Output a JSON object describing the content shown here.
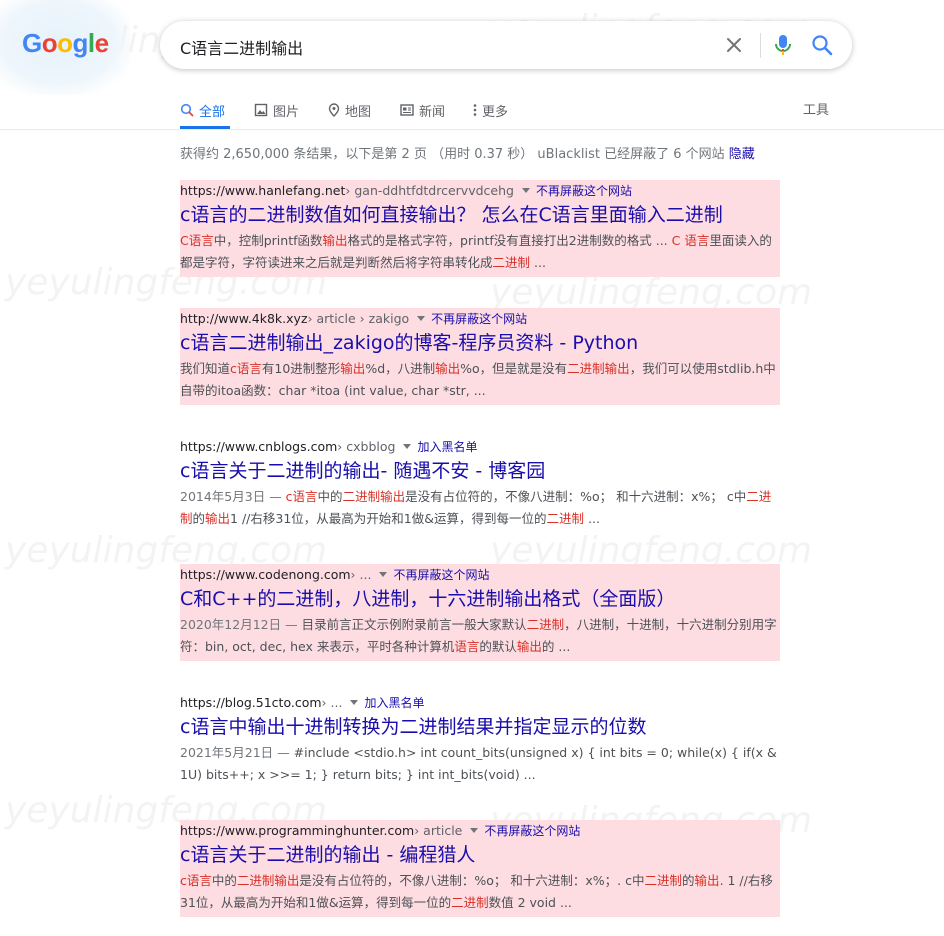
{
  "logo": {
    "text": "Google"
  },
  "search": {
    "query": "C语言二进制输出"
  },
  "tabs": [
    {
      "label": "全部",
      "icon": "search-icon"
    },
    {
      "label": "图片",
      "icon": "image-icon"
    },
    {
      "label": "地图",
      "icon": "map-pin-icon"
    },
    {
      "label": "新闻",
      "icon": "news-icon"
    },
    {
      "label": "更多",
      "icon": "more-vert-icon"
    }
  ],
  "tools_label": "工具",
  "stats": {
    "text": "获得约 2,650,000 条结果，以下是第 2 页 （用时 0.37 秒） uBlacklist 已经屏蔽了 6 个网站",
    "hide_link": "隐藏"
  },
  "results": [
    {
      "domain": "https://www.hanlefang.net",
      "crumbs": " › gan-ddhtfdtdrcervvdcehg",
      "action": "不再屏蔽这个网站",
      "blocked": true,
      "title": "c语言的二进制数值如何直接输出？ 怎么在C语言里面输入二进制",
      "snippet": [
        [
          "C语言",
          true
        ],
        [
          "中，控制printf函数",
          false
        ],
        [
          "输出",
          true
        ],
        [
          "格式的是格式字符，printf没有直接打出2进制数的格式 ... ",
          false
        ],
        [
          "C 语言",
          true
        ],
        [
          "里面读入的都是字符，字符读进来之后就是判断然后将字符串转化成",
          false
        ],
        [
          "二进制",
          true
        ],
        [
          " ...",
          false
        ]
      ]
    },
    {
      "domain": "http://www.4k8k.xyz",
      "crumbs": " › article › zakigo",
      "action": "不再屏蔽这个网站",
      "blocked": true,
      "title": "c语言二进制输出_zakigo的博客-程序员资料 - Python",
      "snippet": [
        [
          "我们知道",
          false
        ],
        [
          "c语言",
          true
        ],
        [
          "有10进制整形",
          false
        ],
        [
          "输出",
          true
        ],
        [
          "%d，八进制",
          false
        ],
        [
          "输出",
          true
        ],
        [
          "%o，但是就是没有",
          false
        ],
        [
          "二进制输出",
          true
        ],
        [
          "，我们可以使用stdlib.h中自带的itoa函数：char *itoa (int value, char *str, ...",
          false
        ]
      ]
    },
    {
      "domain": "https://www.cnblogs.com",
      "crumbs": " › cxbblog",
      "action": "加入黑名单",
      "blocked": false,
      "title": "c语言关于二进制的输出- 随遇不安 - 博客园",
      "date": "2014年5月3日 — ",
      "snippet": [
        [
          "c语言",
          true
        ],
        [
          "中的",
          false
        ],
        [
          "二进制输出",
          true
        ],
        [
          "是没有占位符的，不像八进制：%o； 和十六进制：x%； c中",
          false
        ],
        [
          "二进制",
          true
        ],
        [
          "的",
          false
        ],
        [
          "输出",
          true
        ],
        [
          "1 //右移31位，从最高为开始和1做&运算，得到每一位的",
          false
        ],
        [
          "二进制",
          true
        ],
        [
          " ...",
          false
        ]
      ]
    },
    {
      "domain": "https://www.codenong.com",
      "crumbs": " › ...",
      "action": "不再屏蔽这个网站",
      "blocked": true,
      "title": "C和C++的二进制，八进制，十六进制输出格式（全面版）",
      "date": "2020年12月12日 — ",
      "snippet": [
        [
          "目录前言正文示例附录前言一般大家默认",
          false
        ],
        [
          "二进制",
          true
        ],
        [
          "，八进制，十进制，十六进制分别用字符：bin, oct, dec, hex 来表示，平时各种计算机",
          false
        ],
        [
          "语言",
          true
        ],
        [
          "的默认",
          false
        ],
        [
          "输出",
          true
        ],
        [
          "的 ...",
          false
        ]
      ]
    },
    {
      "domain": "https://blog.51cto.com",
      "crumbs": " › ...",
      "action": "加入黑名单",
      "blocked": false,
      "title": "c语言中输出十进制转换为二进制结果并指定显示的位数",
      "date": "2021年5月21日 — ",
      "snippet": [
        [
          "#include <stdio.h> int count_bits(unsigned x) { int bits = 0; while(x) { if(x & 1U) bits++; x >>= 1; } return bits; } int int_bits(void) ...",
          false
        ]
      ]
    },
    {
      "domain": "https://www.programminghunter.com",
      "crumbs": " › article",
      "action": "不再屏蔽这个网站",
      "blocked": true,
      "title": "c语言关于二进制的输出 - 编程猎人",
      "snippet": [
        [
          "c语言",
          true
        ],
        [
          "中的",
          false
        ],
        [
          "二进制输出",
          true
        ],
        [
          "是没有占位符的，不像八进制：%o； 和十六进制：x%；. c中",
          false
        ],
        [
          "二进制",
          true
        ],
        [
          "的",
          false
        ],
        [
          "输出",
          true
        ],
        [
          ". 1 //右移31位，从最高为开始和1做&运算，得到每一位的",
          false
        ],
        [
          "二进制",
          true
        ],
        [
          "数值 2 void ...",
          false
        ]
      ]
    }
  ],
  "watermark": "yeyulingfeng.com",
  "colors": {
    "link": "#1a0dab",
    "accent": "#1a73e8",
    "blocked_bg": "#fddde2",
    "highlight": "#d93025"
  }
}
